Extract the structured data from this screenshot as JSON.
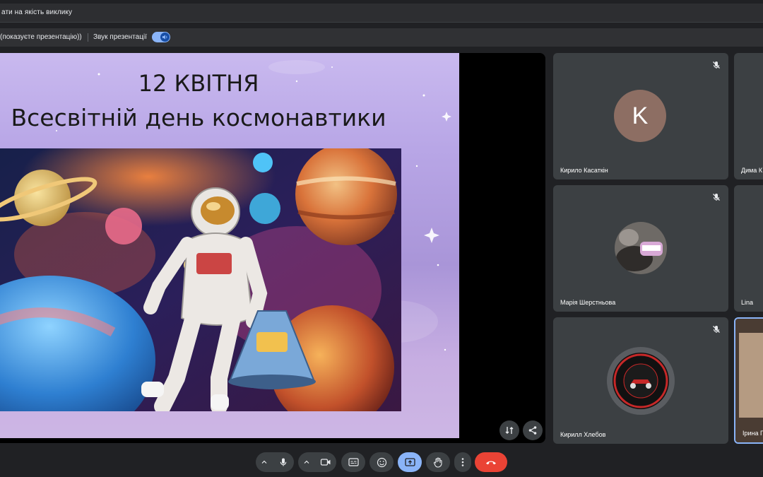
{
  "notice": {
    "text": "ати на якість виклику"
  },
  "presentation_bar": {
    "stop_label": "(показуєте презентацію))",
    "sound_label": "Звук презентації",
    "sound_on": true
  },
  "slide": {
    "title_line1": "12 КВІТНЯ",
    "title_line2": "Всесвітній день космонавтики"
  },
  "participants": [
    {
      "name": "Кирило Касаткін",
      "avatar_letter": "K",
      "avatar_color": "#8d6e63",
      "muted": true
    },
    {
      "name": "Дима К",
      "muted": false
    },
    {
      "name": "Марія Шерстньова",
      "avatar": "photo",
      "muted": true
    },
    {
      "name": "Lina",
      "muted": false
    },
    {
      "name": "Кирилл Хлебов",
      "avatar": "logo",
      "muted": true
    },
    {
      "name": "Ірина Г",
      "avatar": "video",
      "muted": false
    }
  ],
  "controls": {
    "items": [
      "mic-icon",
      "camera-icon",
      "captions-icon",
      "emoji-icon",
      "present-icon",
      "raise-hand-icon",
      "more-icon",
      "end-call-icon"
    ],
    "present_active_color": "#8ab4f8",
    "end_call_color": "#ea4335"
  },
  "colors": {
    "accent": "#8ab4f8",
    "background": "#202124",
    "tile": "#3c4043"
  }
}
